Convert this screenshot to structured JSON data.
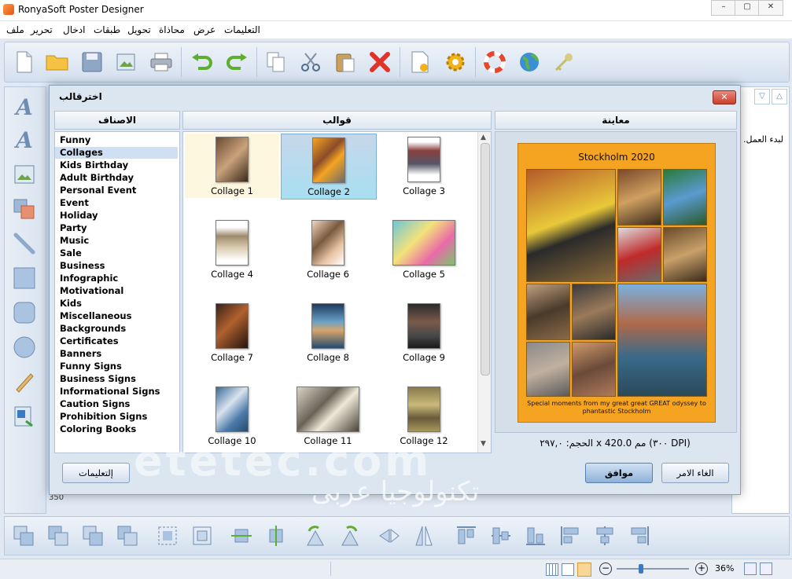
{
  "window": {
    "title": "RonyaSoft Poster Designer",
    "controls": [
      "–",
      "▢",
      "✕"
    ]
  },
  "menu": [
    "التعليمات",
    "عرض",
    "محاذاة",
    "تحويل",
    "طبقات",
    "ادخال",
    "تحرير",
    "ملف"
  ],
  "dialog": {
    "title": "اخترقالب",
    "close_label": "✕",
    "headers": {
      "categories": "الاصناف",
      "templates": "قوالب",
      "preview": "معاينة"
    },
    "categories": [
      "Funny",
      "Collages",
      "Kids Birthday",
      "Adult Birthday",
      "Personal Event",
      "Event",
      "Holiday",
      "Party",
      "Music",
      "Sale",
      "Business",
      "Infographic",
      "Motivational",
      "Kids",
      "Miscellaneous",
      "Backgrounds",
      "Certificates",
      "Banners",
      "Funny Signs",
      "Business Signs",
      "Informational Signs",
      "Caution Signs",
      "Prohibition Signs",
      "Coloring Books"
    ],
    "selected_category": "Collages",
    "templates": [
      "Collage 1",
      "Collage 2",
      "Collage 3",
      "Collage 4",
      "Collage 6",
      "Collage 5",
      "Collage 7",
      "Collage 8",
      "Collage 9",
      "Collage 10",
      "Collage 11",
      "Collage 12"
    ],
    "selected_template": "Collage 2",
    "preview": {
      "poster_title": "Stockholm 2020",
      "poster_caption": "Special moments from my great great GREAT odyssey to phantastic Stockholm",
      "dimensions": "الحجم: ٢٩٧,٠ x 420.0 مم (٣٠٠ DPI)"
    },
    "buttons": {
      "help": "إلتعليمات",
      "ok": "موافق",
      "cancel": "الغاء الامر"
    }
  },
  "background": {
    "workspace_hint": ".لبدء العمل",
    "ruler_label": "350"
  },
  "statusbar": {
    "zoom": "36%"
  },
  "watermark": {
    "latin": "etetec.com",
    "arabic": "تكنولوجيا عربى"
  },
  "colors": {
    "accent": "#2a6ebb",
    "poster": "#f5a421",
    "selection": "#cfe0f4"
  }
}
